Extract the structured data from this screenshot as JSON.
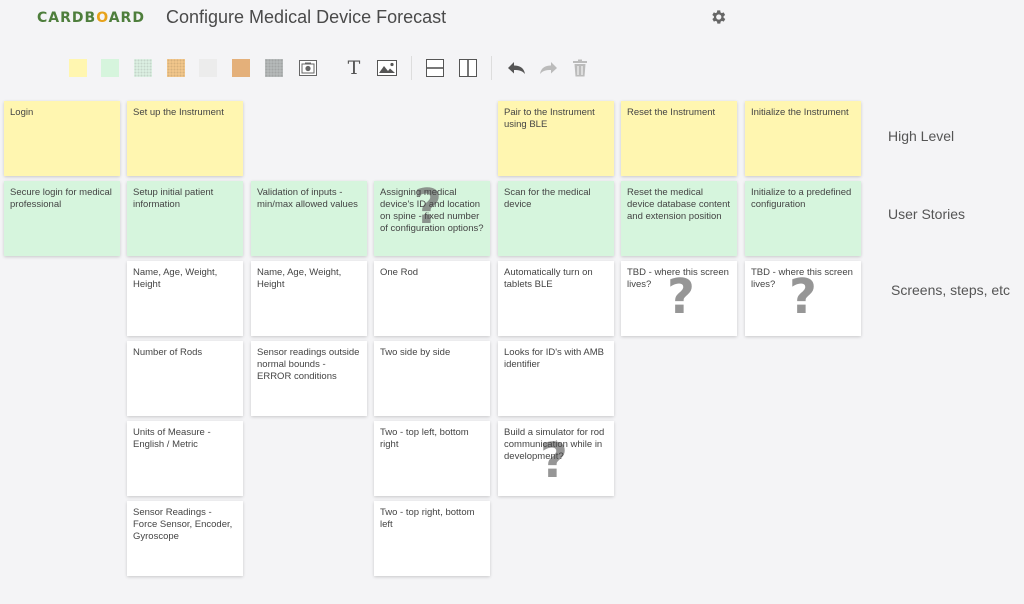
{
  "app": {
    "logo": {
      "part1": "CARD",
      "part2": "B",
      "part3": "O",
      "part4": "ARD"
    },
    "title": "Configure Medical Device Forecast"
  },
  "toolbar": {
    "swatches": [
      {
        "name": "yellow",
        "color": "#fff6b0"
      },
      {
        "name": "mint",
        "color": "#d6f5dd"
      },
      {
        "name": "light-green-pattern",
        "color": "#dff3e6"
      },
      {
        "name": "orange-pattern",
        "color": "#f5c98d"
      },
      {
        "name": "light-gray",
        "color": "#ececec"
      },
      {
        "name": "tan",
        "color": "#e4b07a"
      },
      {
        "name": "gray-pattern",
        "color": "#b8bcbc"
      }
    ],
    "text_tool_glyph": "T"
  },
  "cards": [
    {
      "id": "c1",
      "color": "yellow",
      "text": "Login"
    },
    {
      "id": "c2",
      "color": "yellow",
      "text": "Set up the Instrument"
    },
    {
      "id": "c3",
      "color": "yellow",
      "text": "Pair to the Instrument using BLE"
    },
    {
      "id": "c4",
      "color": "yellow",
      "text": "Reset the Instrument"
    },
    {
      "id": "c5",
      "color": "yellow",
      "text": "Initialize the Instrument"
    },
    {
      "id": "c6",
      "color": "green",
      "text": "Secure login for medical professional"
    },
    {
      "id": "c7",
      "color": "green",
      "text": "Setup initial patient information"
    },
    {
      "id": "c8",
      "color": "green",
      "text": "Validation of inputs - min/max allowed values"
    },
    {
      "id": "c9",
      "color": "green",
      "text": "Assigning medical device's ID and location on spine - fixed number of configuration options?",
      "mark": "?"
    },
    {
      "id": "c10",
      "color": "green",
      "text": "Scan for the medical device"
    },
    {
      "id": "c11",
      "color": "green",
      "text": "Reset the medical device database content and extension position"
    },
    {
      "id": "c12",
      "color": "green",
      "text": "Initialize to a predefined configuration"
    },
    {
      "id": "c13",
      "color": "white",
      "text": "Name, Age, Weight, Height"
    },
    {
      "id": "c14",
      "color": "white",
      "text": "Name, Age, Weight, Height"
    },
    {
      "id": "c15",
      "color": "white",
      "text": "One Rod"
    },
    {
      "id": "c16",
      "color": "white",
      "text": "Automatically turn on tablets BLE"
    },
    {
      "id": "c17",
      "color": "white",
      "text": "TBD - where this screen lives?",
      "mark": "?"
    },
    {
      "id": "c18",
      "color": "white",
      "text": "TBD - where this screen lives?",
      "mark": "?"
    },
    {
      "id": "c19",
      "color": "white",
      "text": "Number of Rods"
    },
    {
      "id": "c20",
      "color": "white",
      "text": "Sensor readings outside normal bounds - ERROR conditions"
    },
    {
      "id": "c21",
      "color": "white",
      "text": "Two side by side"
    },
    {
      "id": "c22",
      "color": "white",
      "text": "Looks for ID's with AMB identifier"
    },
    {
      "id": "c23",
      "color": "white",
      "text": "Units of Measure - English / Metric"
    },
    {
      "id": "c24",
      "color": "white",
      "text": "Two - top left, bottom right"
    },
    {
      "id": "c25",
      "color": "white",
      "text": "Build a simulator for rod communication while in development?",
      "mark": "?"
    },
    {
      "id": "c26",
      "color": "white",
      "text": "Sensor Readings - Force Sensor, Encoder, Gyroscope"
    },
    {
      "id": "c27",
      "color": "white",
      "text": "Two - top right, bottom left"
    }
  ],
  "row_labels": {
    "high_level": "High Level",
    "user_stories": "User Stories",
    "screens": "Screens, steps, etc"
  }
}
